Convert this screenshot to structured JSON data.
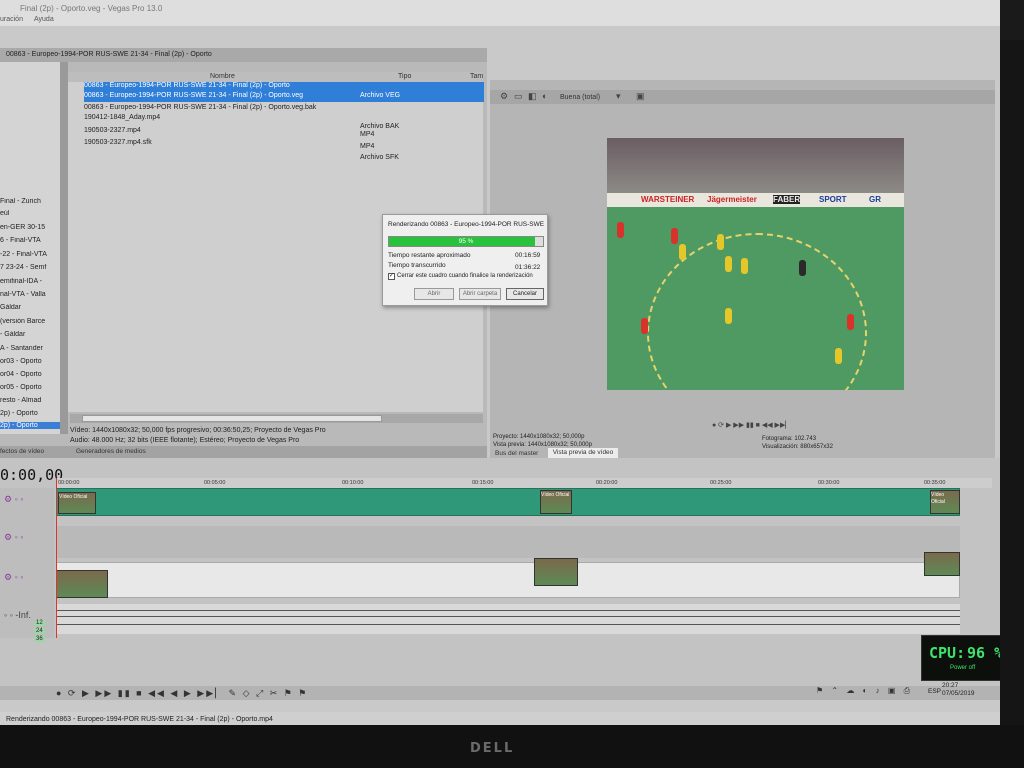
{
  "app": {
    "title": "Final (2p) - Oporto.veg - Vegas Pro 13.0",
    "menu": [
      "uración",
      "Ayuda"
    ]
  },
  "explorer": {
    "path": "00863 - Europeo-1994-POR RUS-SWE 21-34 - Final (2p) - Oporto",
    "columns": {
      "name": "Nombre",
      "type": "Tipo",
      "extra": "Tam"
    },
    "files": [
      {
        "name": "00863 - Europeo-1994-POR RUS-SWE 21-34 - Final (2p) - Oporto",
        "type": "",
        "selected": true
      },
      {
        "name": "00863 - Europeo-1994-POR RUS-SWE 21-34 - Final (2p) - Oporto.veg",
        "type": "Archivo VEG",
        "selected": true
      },
      {
        "name": "190412-1848_Aday.mp4",
        "type": "Archivo BAK",
        "selected": false
      },
      {
        "name": "190503-2327.mp4",
        "type": "MP4",
        "selected": false
      },
      {
        "name": "190503-2327.mp4.sfk",
        "type": "MP4",
        "selected": false
      },
      {
        "name": "",
        "type": "Archivo SFK",
        "selected": false
      }
    ],
    "row1_dup": "00863 - Europeo-1994-POR RUS-SWE 21-34 - Final (2p) - Oporto.veg.bak",
    "video_info": "Vídeo: 1440x1080x32; 50,000 fps progresivo; 00:36:50,25; Proyecto de Vegas Pro",
    "audio_info": "Audio: 48.000 Hz; 32 bits (IEEE flotante); Estéreo; Proyecto de Vegas Pro",
    "tabs": [
      "fectos de vídeo",
      "Generadores de medios"
    ]
  },
  "tree": {
    "items": [
      {
        "label": "Final - Zurich",
        "selected": false
      },
      {
        "label": "eúl",
        "selected": false
      },
      {
        "label": "en-GER 30-15",
        "selected": false
      },
      {
        "label": "6 - Final-VTA",
        "selected": false
      },
      {
        "label": "-22 - Final-VTA",
        "selected": false
      },
      {
        "label": "7 23-24 - Semf",
        "selected": false
      },
      {
        "label": "emifinal-IDA -",
        "selected": false
      },
      {
        "label": "nal-VTA - Valla",
        "selected": false
      },
      {
        "label": "Gáldar",
        "selected": false
      },
      {
        "label": "(versión Barce",
        "selected": false
      },
      {
        "label": "- Gáldar",
        "selected": false
      },
      {
        "label": "A - Santander",
        "selected": false
      },
      {
        "label": "or03 - Oporto",
        "selected": false
      },
      {
        "label": "or04 - Oporto",
        "selected": false
      },
      {
        "label": "or05 - Oporto",
        "selected": false
      },
      {
        "label": "resto - Almad",
        "selected": false
      },
      {
        "label": "2p) - Oporto",
        "selected": false
      },
      {
        "label": "2p) - Oporto",
        "selected": true
      }
    ]
  },
  "preview": {
    "quality": "Buena (total)",
    "project_lbl": "Proyecto:",
    "project_val": "1440x1080x32; 50,000p",
    "preview_lbl": "Vista previa:",
    "preview_val": "1440x1080x32; 50,000p",
    "frame_lbl": "Fotograma:",
    "frame_val": "102.743",
    "display_lbl": "Visualización:",
    "display_val": "880x657x32",
    "tabs": [
      "Bus del master",
      "Vista previa de vídeo"
    ],
    "ads": [
      "WARSTEINER",
      "Jägermeister",
      "FABER",
      "SPORT",
      "GR"
    ]
  },
  "render_dialog": {
    "title": "Renderizando 00863 - Europeo-1994-POR RUS-SWE",
    "progress_pct": 95,
    "progress_label": "95 %",
    "remaining_lbl": "Tiempo restante aproximado",
    "remaining_val": "00:16:59",
    "elapsed_lbl": "Tiempo transcurrido",
    "elapsed_val": "01:36:22",
    "close_when_done": "Cerrar este cuadro cuando finalice la renderización",
    "buttons": {
      "open": "Abrir",
      "open_folder": "Abrir carpeta",
      "cancel": "Cancelar"
    }
  },
  "timeline": {
    "timecode": "0:00,00",
    "ruler": [
      "00:00:00",
      "00:05:00",
      "00:10:00",
      "00:15:00",
      "00:20:00",
      "00:25:00",
      "00:30:00",
      "00:35:00"
    ],
    "rate": "12",
    "rate2": "24",
    "rate3": "36",
    "clip_labels": [
      "Vídeo Oficial",
      "Vídeo Oficial",
      "Vídeo Oficial"
    ]
  },
  "status": {
    "text": "Renderizando 00863 - Europeo-1994-POR RUS-SWE 21-34 - Final (2p) - Oporto.mp4",
    "time": "20:27",
    "date": "07/05/2019",
    "lang": "ESP"
  },
  "cpu": {
    "label": "CPU:",
    "value": "96 %",
    "sub": "Power off"
  },
  "monitor": {
    "brand": "DELL"
  },
  "colors": {
    "accent": "#2f7fd8",
    "progress": "#29c23d",
    "track": "#2f9879",
    "cpu": "#3fe26a"
  }
}
